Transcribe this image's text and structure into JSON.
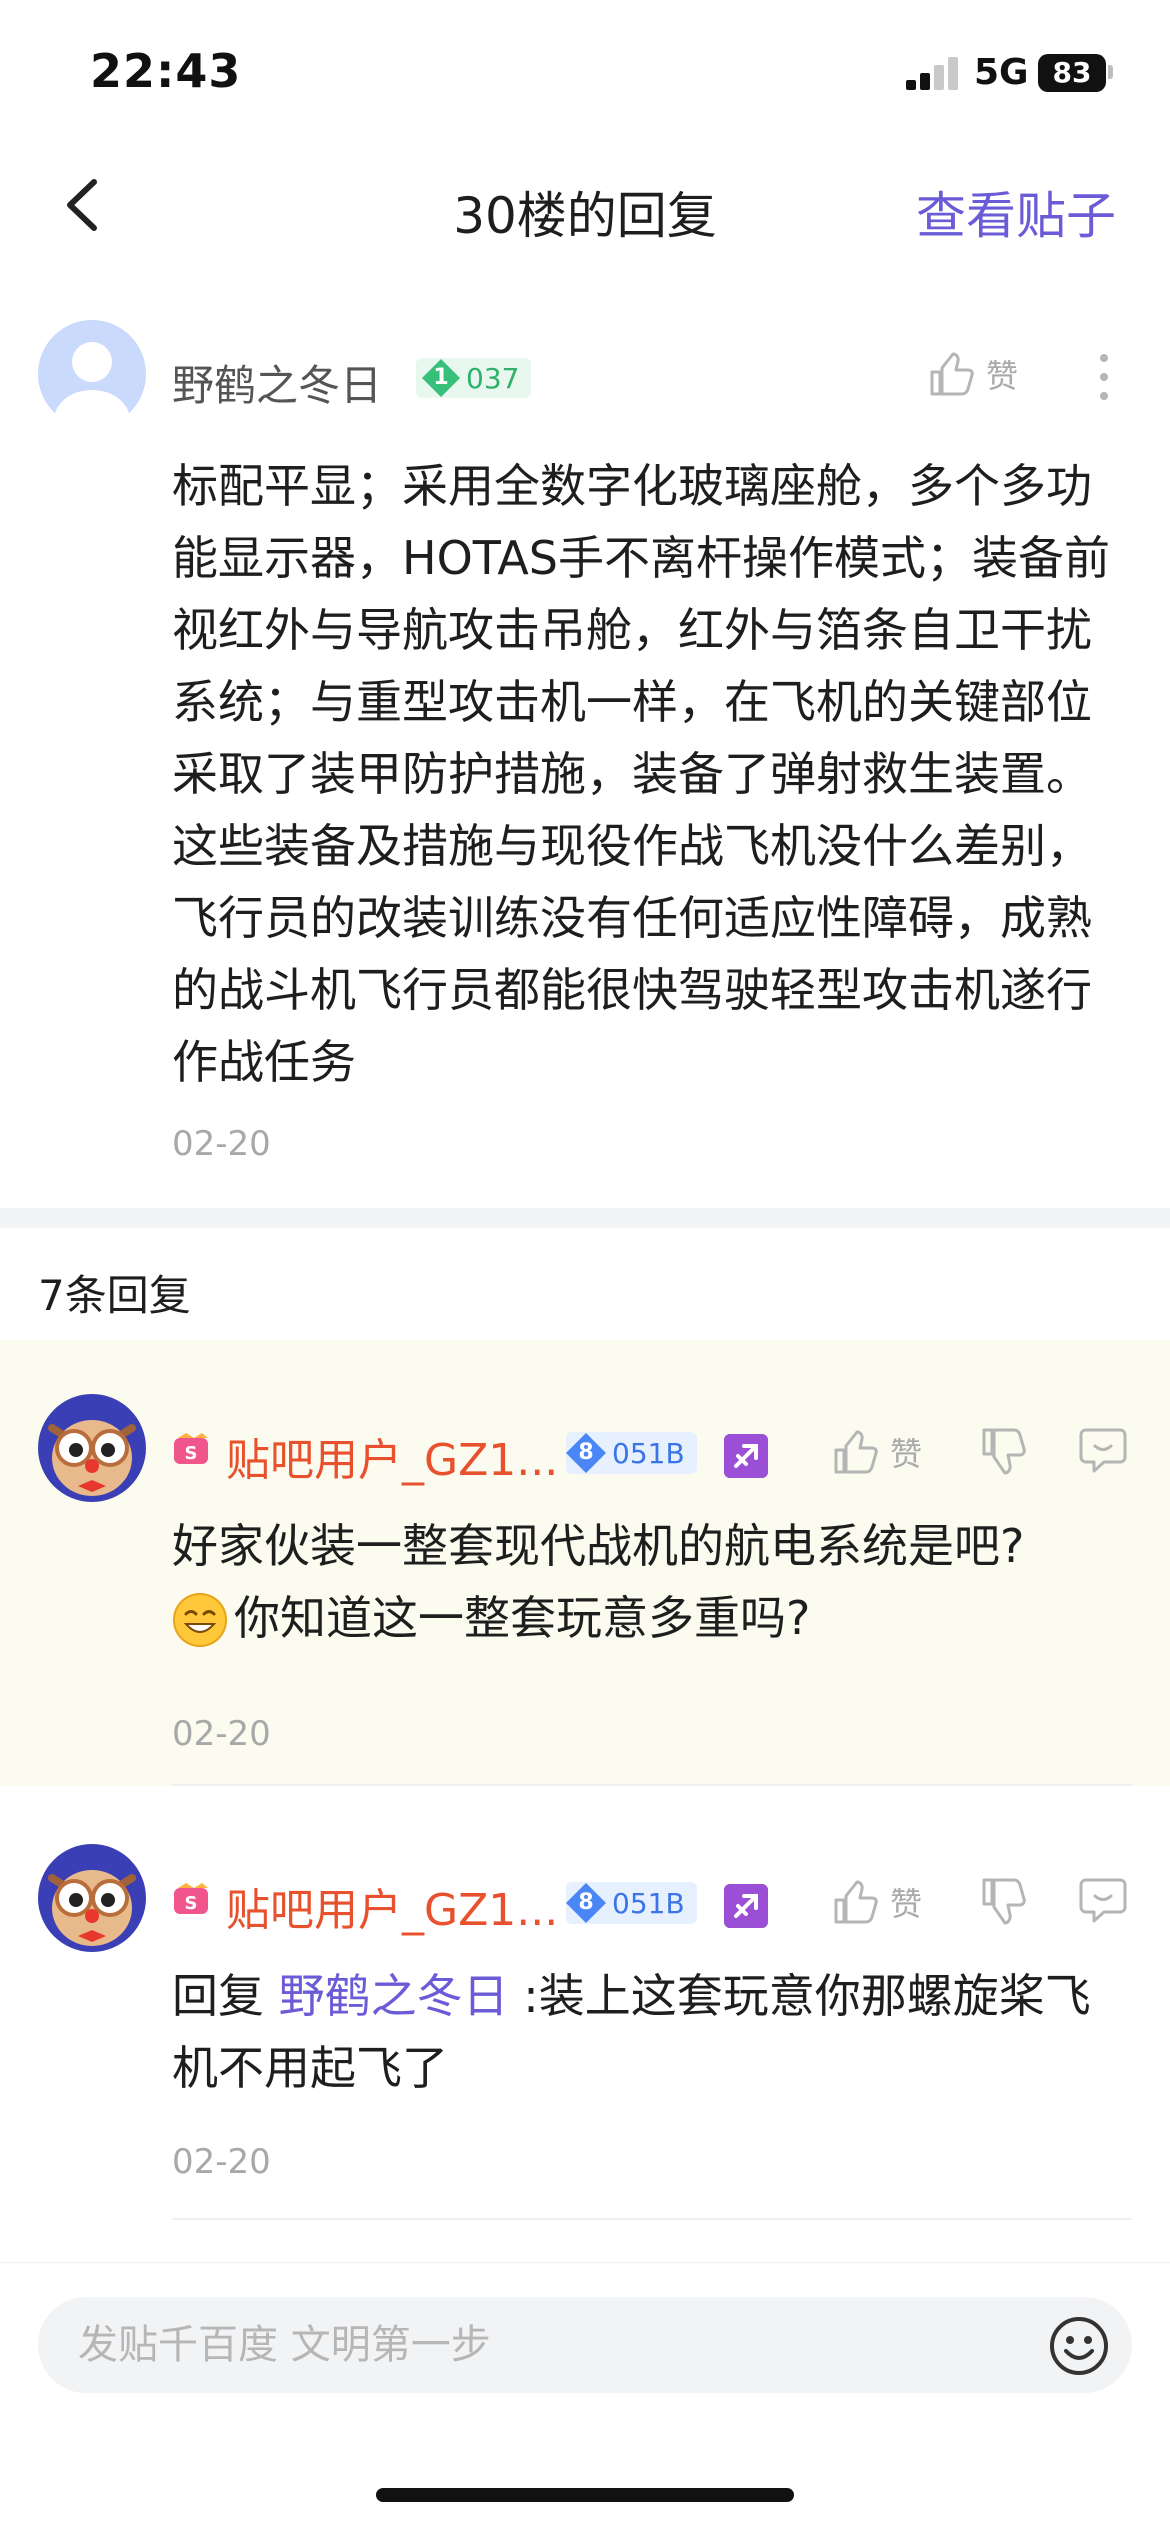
{
  "status_bar": {
    "time": "22:43",
    "network": "5G",
    "battery": "83"
  },
  "nav": {
    "title": "30楼的回复",
    "view_post": "查看贴子"
  },
  "post": {
    "author": "野鹤之冬日",
    "level": "1",
    "level_points": "037",
    "like_label": "赞",
    "body": "标配平显；采用全数字化玻璃座舱，多个多功能显示器，HOTAS手不离杆操作模式；装备前视红外与导航攻击吊舱，红外与箔条自卫干扰系统；与重型攻击机一样，在飞机的关键部位采取了装甲防护措施，装备了弹射救生装置。这些装备及措施与现役作战飞机没什么差别，飞行员的改装训练没有任何适应性障碍，成熟的战斗机飞行员都能很快驾驶轻型攻击机遂行作战任务",
    "date": "02-20"
  },
  "reply_count": "7条回复",
  "replies": [
    {
      "author": "贴吧用户_GZ1...",
      "level": "8",
      "level_code": "051B",
      "like_label": "赞",
      "body_line1": "好家伙装一整套现代战机的航电系统是吧?",
      "body_line2": "你知道这一整套玩意多重吗?",
      "date": "02-20"
    },
    {
      "author": "贴吧用户_GZ1...",
      "level": "8",
      "level_code": "051B",
      "like_label": "赞",
      "reply_prefix": "回复 ",
      "mention": "野鹤之冬日",
      "body": " :装上这套玩意你那螺旋桨飞机不用起飞了",
      "date": "02-20"
    }
  ],
  "composer": {
    "placeholder": "发贴千百度 文明第一步"
  },
  "colors": {
    "accent": "#6b5bd6",
    "username_red": "#e8512d",
    "highlight_bg": "#fcfbf0"
  },
  "icons": [
    "back-chevron-icon",
    "thumbs-up-icon",
    "more-vertical-icon",
    "thumbs-down-icon",
    "comment-icon",
    "smiley-icon",
    "tieba-vip-icon",
    "sagittarius-badge-icon"
  ]
}
